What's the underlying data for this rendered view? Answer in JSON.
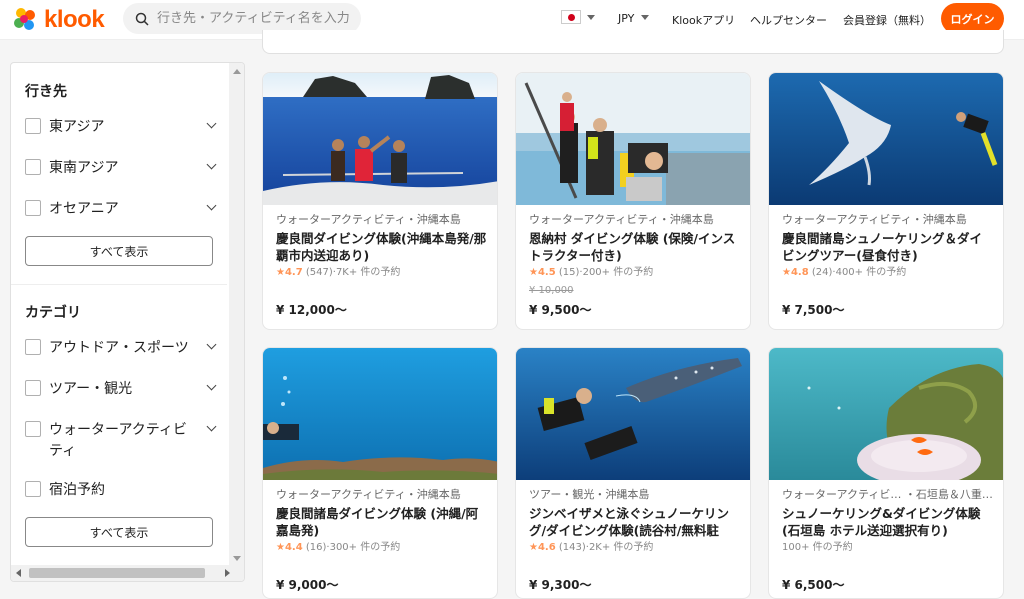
{
  "header": {
    "brand": "klook",
    "search_placeholder": "行き先・アクティビティ名を入力",
    "currency": "JPY",
    "links": [
      "Klookアプリ",
      "ヘルプセンター",
      "会員登録（無料）"
    ],
    "login": "ログイン",
    "colors": {
      "brand": "#ff5b00"
    }
  },
  "sidebar": {
    "destination": {
      "title": "行き先",
      "items": [
        "東アジア",
        "東南アジア",
        "オセアニア"
      ],
      "show_all": "すべて表示"
    },
    "category": {
      "title": "カテゴリ",
      "items": [
        "アウトドア・スポーツ",
        "ツアー・観光",
        "ウォーターアクティビティ",
        "宿泊予約"
      ],
      "show_all": "すべて表示"
    }
  },
  "cards": [
    {
      "category": "ウォーターアクティビティ・沖縄本島",
      "title": "慶良間ダイビング体験(沖縄本島発/那覇市内送迎あり)",
      "score": "4.7",
      "rating_meta": "(547)·7K+ 件の予約",
      "old_price": "",
      "price": "¥ 12,000〜"
    },
    {
      "category": "ウォーターアクティビティ・沖縄本島",
      "title": "恩納村 ダイビング体験 (保険/インストラクター付き)",
      "score": "4.5",
      "rating_meta": "(15)·200+ 件の予約",
      "old_price": "¥ 10,000",
      "price": "¥ 9,500〜"
    },
    {
      "category": "ウォーターアクティビティ・沖縄本島",
      "title": "慶良間諸島シュノーケリング＆ダイビングツアー(昼食付き)",
      "score": "4.8",
      "rating_meta": "(24)·400+ 件の予約",
      "old_price": "",
      "price": "¥ 7,500〜"
    },
    {
      "category": "ウォーターアクティビティ・沖縄本島",
      "title": "慶良間諸島ダイビング体験 (沖縄/阿嘉島発)",
      "score": "4.4",
      "rating_meta": "(16)·300+ 件の予約",
      "old_price": "",
      "price": "¥ 9,000〜"
    },
    {
      "category": "ツアー・観光・沖縄本島",
      "title": "ジンベイザメと泳ぐシュノーケリング/ダイビング体験(読谷村/無料駐車…",
      "score": "4.6",
      "rating_meta": "(143)·2K+ 件の予約",
      "old_price": "",
      "price": "¥ 9,300〜"
    },
    {
      "category": "ウォーターアクティビ… ・石垣島＆八重山…",
      "title": "シュノーケリング&ダイビング体験 (石垣島 ホテル送迎選択有り)",
      "score": "",
      "rating_meta": "100+ 件の予約",
      "old_price": "",
      "price": "¥ 6,500〜"
    }
  ]
}
